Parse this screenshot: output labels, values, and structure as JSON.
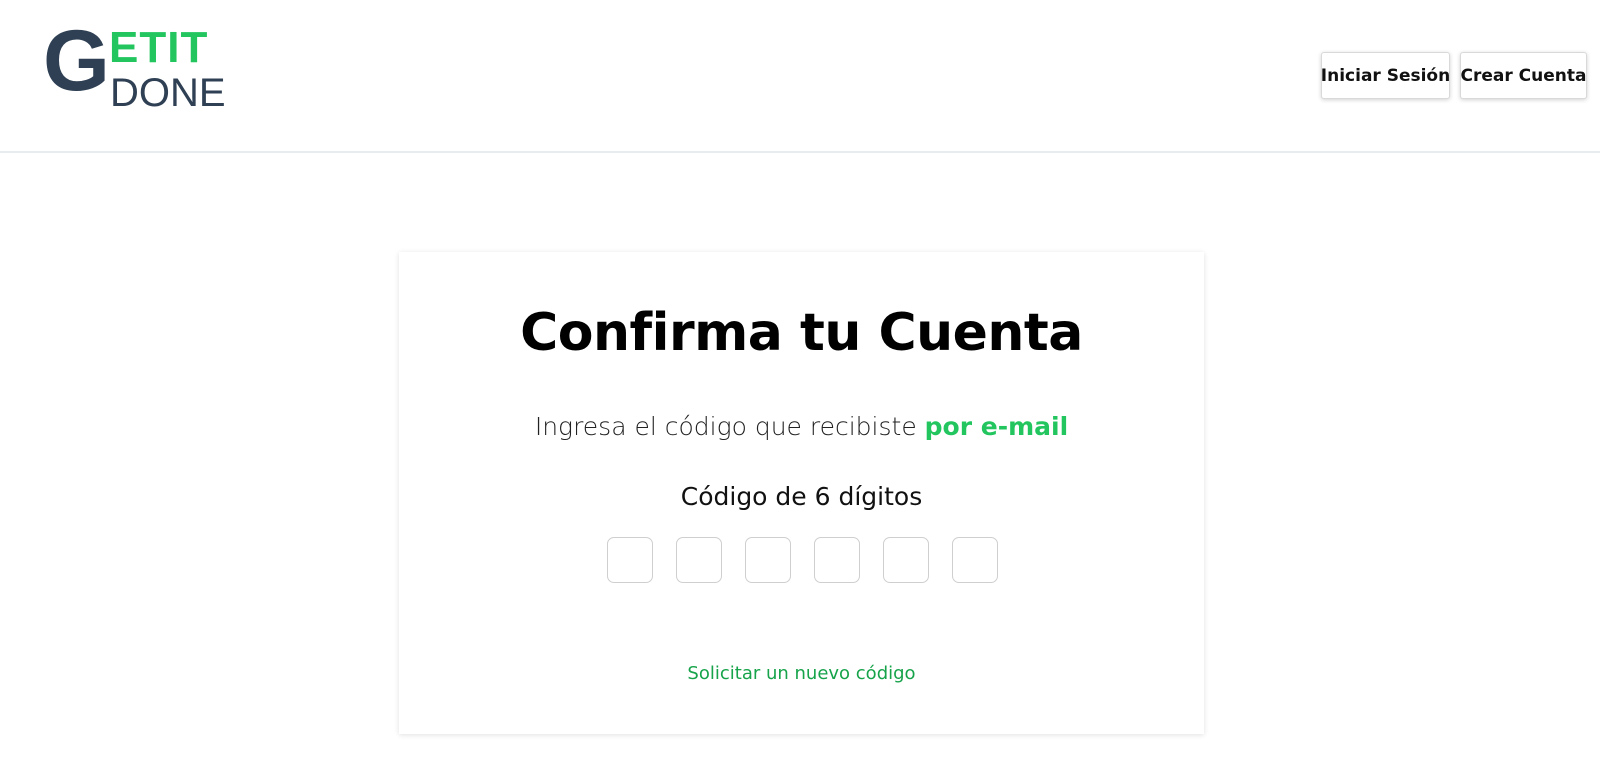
{
  "logo": {
    "letter": "G",
    "top": "ETIT",
    "bottom": "DONE"
  },
  "nav": {
    "login_label": "Iniciar Sesión",
    "signup_label": "Crear Cuenta"
  },
  "card": {
    "title": "Confirma tu Cuenta",
    "subtitle_prefix": "Ingresa el código que recibiste ",
    "subtitle_accent": "por e-mail",
    "code_label": "Código de 6 dígitos",
    "code_values": [
      "",
      "",
      "",
      "",
      "",
      ""
    ],
    "resend_label": "Solicitar un nuevo código"
  },
  "colors": {
    "accent": "#22c55e",
    "brand_dark": "#2f4054",
    "link": "#16a34a"
  }
}
